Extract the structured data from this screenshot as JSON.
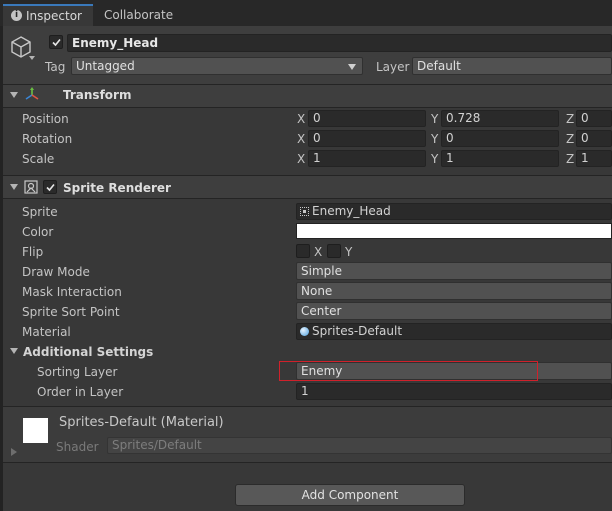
{
  "tabs": {
    "inspector": "Inspector",
    "collaborate": "Collaborate"
  },
  "object": {
    "name": "Enemy_Head",
    "tag_label": "Tag",
    "tag_value": "Untagged",
    "layer_label": "Layer",
    "layer_value": "Default"
  },
  "transform": {
    "title": "Transform",
    "position": {
      "label": "Position",
      "x": "0",
      "y": "0.728",
      "z": "0"
    },
    "rotation": {
      "label": "Rotation",
      "x": "0",
      "y": "0",
      "z": "0"
    },
    "scale": {
      "label": "Scale",
      "x": "1",
      "y": "1",
      "z": "1"
    },
    "axis_x": "X",
    "axis_y": "Y",
    "axis_z": "Z"
  },
  "sprite_renderer": {
    "title": "Sprite Renderer",
    "sprite_label": "Sprite",
    "sprite_value": "Enemy_Head",
    "color_label": "Color",
    "color_value": "#ffffff",
    "flip_label": "Flip",
    "flip_x": "X",
    "flip_y": "Y",
    "draw_mode_label": "Draw Mode",
    "draw_mode_value": "Simple",
    "mask_label": "Mask Interaction",
    "mask_value": "None",
    "sort_point_label": "Sprite Sort Point",
    "sort_point_value": "Center",
    "material_label": "Material",
    "material_value": "Sprites-Default",
    "additional_title": "Additional Settings",
    "sorting_layer_label": "Sorting Layer",
    "sorting_layer_value": "Enemy",
    "order_label": "Order in Layer",
    "order_value": "1"
  },
  "material": {
    "title": "Sprites-Default (Material)",
    "shader_label": "Shader",
    "shader_value": "Sprites/Default"
  },
  "add_component": "Add Component",
  "highlight_color": "#d0212b"
}
